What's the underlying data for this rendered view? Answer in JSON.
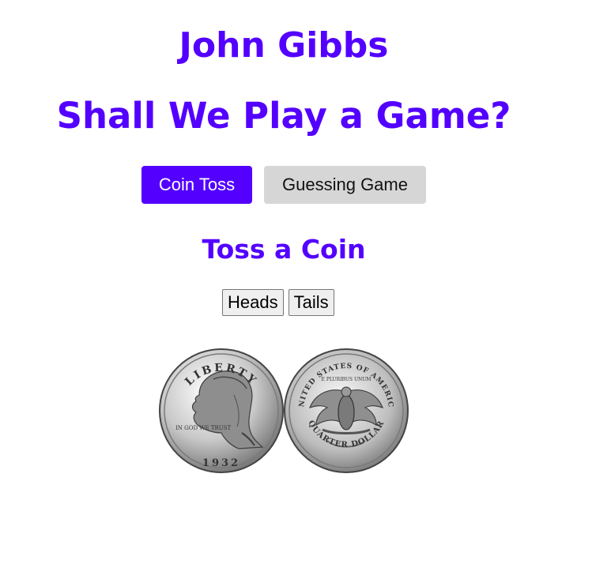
{
  "header": {
    "name": "John Gibbs",
    "subtitle": "Shall We Play a Game?"
  },
  "nav": {
    "tabs": [
      {
        "label": "Coin Toss",
        "active": true
      },
      {
        "label": "Guessing Game",
        "active": false
      }
    ]
  },
  "coin_toss": {
    "title": "Toss a Coin",
    "heads_label": "Heads",
    "tails_label": "Tails",
    "coin_front_text": "LIBERTY",
    "coin_front_motto": "IN GOD WE TRUST",
    "coin_front_year": "1932",
    "coin_back_text": "UNITED STATES OF AMERICA",
    "coin_back_motto": "E PLURIBUS UNUM",
    "coin_back_value": "QUARTER DOLLAR"
  },
  "colors": {
    "accent": "#5300ff",
    "inactive_tab": "#d6d6d6"
  }
}
